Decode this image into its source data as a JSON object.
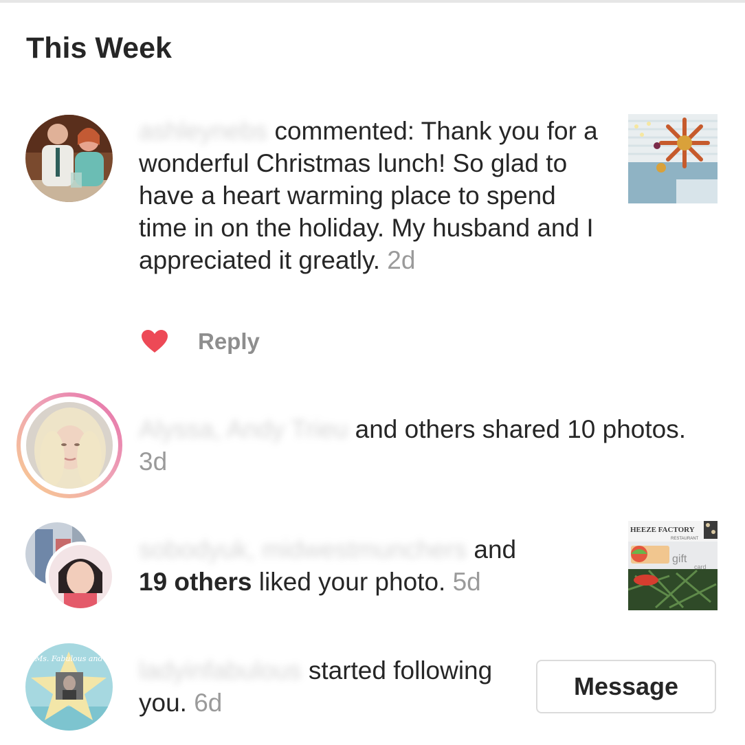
{
  "section": {
    "title": "This Week"
  },
  "notifications": [
    {
      "users": "ashleynebs",
      "text": " commented: Thank you for a wonderful Christmas lunch! So glad to have a heart warming place to spend time in on the holiday. My husband and I appreciated it greatly.",
      "time": "2d",
      "reply_label": "Reply",
      "liked": true
    },
    {
      "users": "Alyssa, Andy Trieu",
      "text": " and others shared 10 photos.",
      "time": "3d"
    },
    {
      "users": "sobodyuk, midwestmunchers",
      "text_a": " and",
      "count": "19 others",
      "text_b": " liked your photo.",
      "time": "5d",
      "thumb_text": {
        "brand": "HEEZE FACTORY",
        "sub": "RESTAURANT",
        "gift": "gift",
        "card": "card"
      }
    },
    {
      "users": "ladyinfabulous",
      "text": " started following you.",
      "time": "6d",
      "button_label": "Message",
      "avatar_text": "Ms. Fabulous and Co"
    }
  ],
  "colors": {
    "heart": "#ed4956",
    "text": "#262626",
    "secondary": "#8e8e8e",
    "story_ring": [
      "#f9ce8c",
      "#e56ea8"
    ]
  },
  "icons": [
    "heart-icon"
  ]
}
